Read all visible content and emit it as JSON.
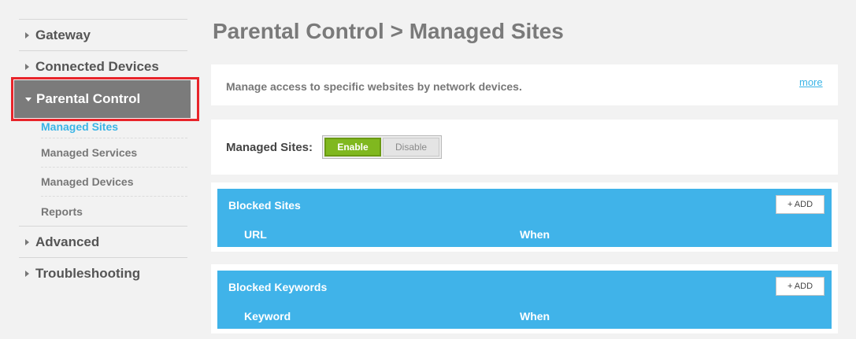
{
  "sidebar": {
    "top_items": [
      {
        "label": "Gateway"
      },
      {
        "label": "Connected Devices"
      }
    ],
    "active_item": {
      "label": "Parental Control"
    },
    "sub_items": [
      {
        "label": "Managed Sites",
        "active": true
      },
      {
        "label": "Managed Services"
      },
      {
        "label": "Managed Devices"
      },
      {
        "label": "Reports"
      }
    ],
    "bottom_items": [
      {
        "label": "Advanced"
      },
      {
        "label": "Troubleshooting"
      }
    ]
  },
  "main": {
    "title": "Parental Control > Managed Sites",
    "description": "Manage access to specific websites by network devices.",
    "more_link": "more",
    "managed_sites": {
      "label": "Managed Sites:",
      "enable_label": "Enable",
      "disable_label": "Disable",
      "state": "Enable"
    },
    "blocked_sites": {
      "title": "Blocked Sites",
      "add_label": "+ ADD",
      "columns": [
        "URL",
        "When"
      ]
    },
    "blocked_keywords": {
      "title": "Blocked Keywords",
      "add_label": "+ ADD",
      "columns": [
        "Keyword",
        "When"
      ]
    }
  },
  "colors": {
    "accent_blue": "#40b3e9",
    "enable_green": "#80b81f",
    "highlight_red": "#e8242a",
    "active_nav_gray": "#7b7b7b"
  }
}
